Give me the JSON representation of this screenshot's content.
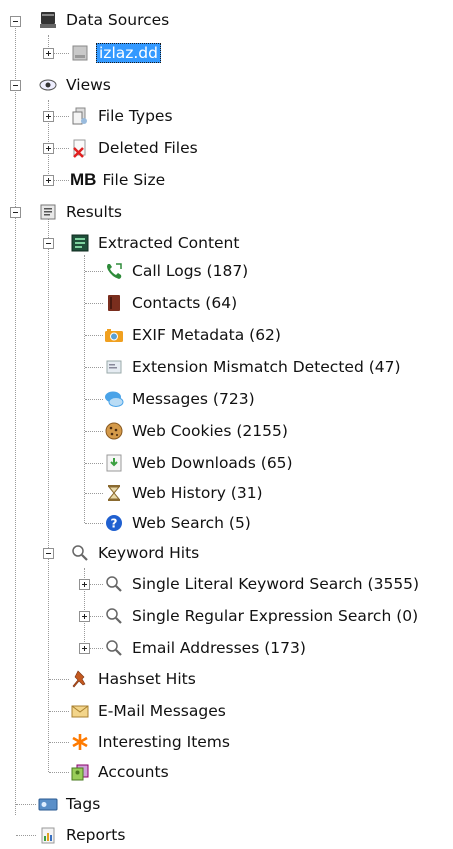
{
  "tree": {
    "data_sources": {
      "label": "Data Sources",
      "icon": "database-icon"
    },
    "image": {
      "label": "izlaz.dd",
      "icon": "disk-image-icon"
    },
    "views": {
      "label": "Views",
      "icon": "eye-icon"
    },
    "file_types": {
      "label": "File Types",
      "icon": "file-types-icon"
    },
    "deleted_files": {
      "label": "Deleted Files",
      "icon": "deleted-file-icon"
    },
    "file_size": {
      "label": "File Size",
      "icon_text": "MB"
    },
    "results": {
      "label": "Results",
      "icon": "results-icon"
    },
    "extracted_content": {
      "label": "Extracted Content",
      "icon": "extracted-content-icon"
    },
    "extracted_items": [
      {
        "label": "Call Logs (187)",
        "icon": "phone-icon"
      },
      {
        "label": "Contacts (64)",
        "icon": "contacts-book-icon"
      },
      {
        "label": "EXIF Metadata (62)",
        "icon": "camera-icon"
      },
      {
        "label": "Extension Mismatch Detected (47)",
        "icon": "mismatch-icon"
      },
      {
        "label": "Messages (723)",
        "icon": "message-icon"
      },
      {
        "label": "Web Cookies (2155)",
        "icon": "cookie-icon"
      },
      {
        "label": "Web Downloads (65)",
        "icon": "download-icon"
      },
      {
        "label": "Web History (31)",
        "icon": "hourglass-icon"
      },
      {
        "label": "Web Search (5)",
        "icon": "help-search-icon"
      }
    ],
    "keyword_hits": {
      "label": "Keyword Hits",
      "icon": "magnifier-icon"
    },
    "keyword_items": [
      {
        "label": "Single Literal Keyword Search (3555)",
        "icon": "magnifier-icon"
      },
      {
        "label": "Single Regular Expression Search (0)",
        "icon": "magnifier-icon"
      },
      {
        "label": "Email Addresses (173)",
        "icon": "magnifier-icon"
      }
    ],
    "hashset_hits": {
      "label": "Hashset Hits",
      "icon": "pushpin-icon"
    },
    "email_messages": {
      "label": "E-Mail Messages",
      "icon": "envelope-icon"
    },
    "interesting_items": {
      "label": "Interesting Items",
      "icon": "asterisk-icon"
    },
    "accounts": {
      "label": "Accounts",
      "icon": "accounts-icon"
    },
    "tags": {
      "label": "Tags",
      "icon": "tag-icon"
    },
    "reports": {
      "label": "Reports",
      "icon": "report-icon"
    }
  },
  "colors": {
    "selection": "#3399ff",
    "tree_lines": "#9a9a9a",
    "deleted_red": "#e02020",
    "asterisk_orange": "#ff7a00"
  }
}
